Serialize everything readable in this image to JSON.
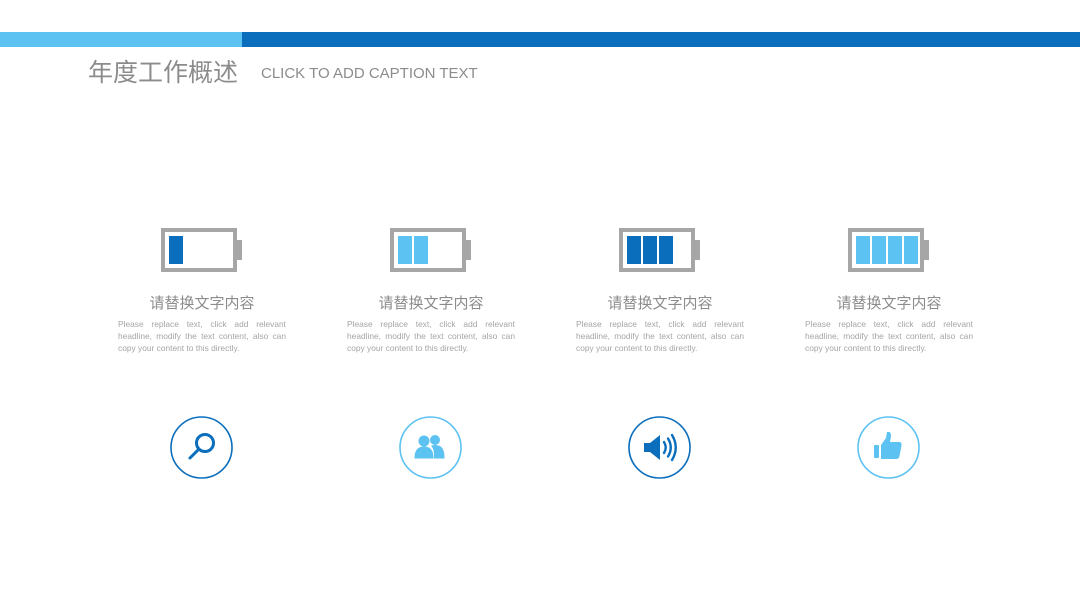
{
  "header": {
    "title": "年度工作概述",
    "caption": "CLICK TO ADD CAPTION TEXT"
  },
  "colors": {
    "accent_dark": "#0a6ebd",
    "accent_light": "#5cc2f2",
    "text_gray": "#8c8c8c",
    "battery_frame": "#a6a6a6"
  },
  "items": [
    {
      "heading": "请替换文字内容",
      "body": "Please replace text, click add relevant headline, modify the text content, also can copy your content to this directly.",
      "battery_level": 1,
      "battery_color": "#0a6ebd",
      "icon": "magnifier-icon",
      "circle_color": "#0a6ebd"
    },
    {
      "heading": "请替换文字内容",
      "body": "Please replace text, click add relevant headline, modify the text content, also can copy your content to this directly.",
      "battery_level": 2,
      "battery_color": "#5cc2f2",
      "icon": "users-icon",
      "circle_color": "#5cc2f2"
    },
    {
      "heading": "请替换文字内容",
      "body": "Please replace text, click add relevant headline, modify the text content, also can copy your content to this directly.",
      "battery_level": 3,
      "battery_color": "#0a6ebd",
      "icon": "speaker-icon",
      "circle_color": "#0a6ebd"
    },
    {
      "heading": "请替换文字内容",
      "body": "Please replace text, click add relevant headline, modify the text content, also can copy your content to this directly.",
      "battery_level": 4,
      "battery_color": "#5cc2f2",
      "icon": "thumbs-up-icon",
      "circle_color": "#5cc2f2"
    }
  ]
}
